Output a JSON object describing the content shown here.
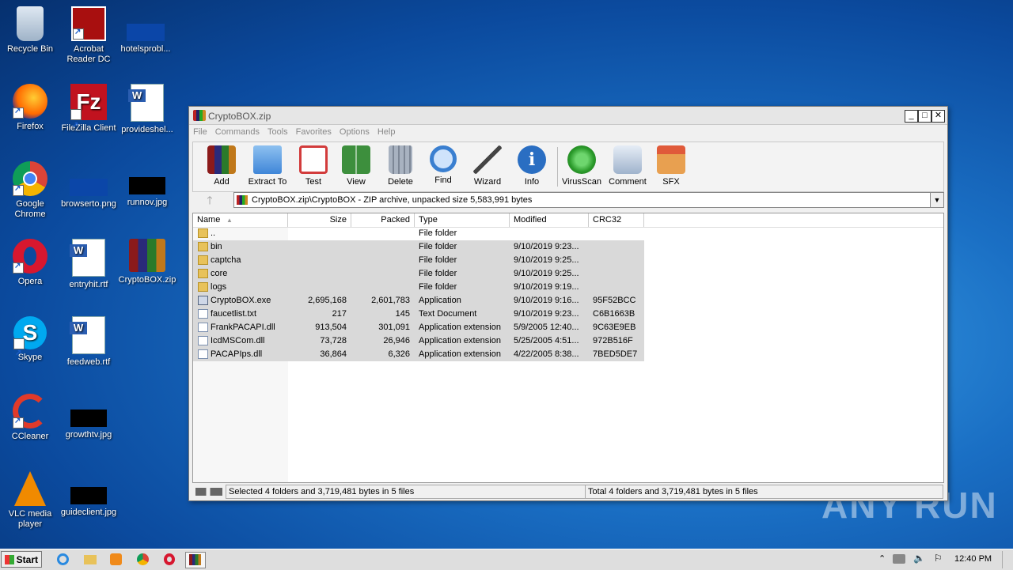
{
  "desktop": {
    "icons": [
      {
        "label": "Recycle Bin"
      },
      {
        "label": "Acrobat Reader DC"
      },
      {
        "label": "hotelsprobl..."
      },
      {
        "label": "Firefox"
      },
      {
        "label": "FileZilla Client"
      },
      {
        "label": "provideshel..."
      },
      {
        "label": "Google Chrome"
      },
      {
        "label": "browserto.png"
      },
      {
        "label": "runnov.jpg"
      },
      {
        "label": "Opera"
      },
      {
        "label": "entryhit.rtf"
      },
      {
        "label": "CryptoBOX.zip"
      },
      {
        "label": "Skype"
      },
      {
        "label": "feedweb.rtf"
      },
      {
        "label": "CCleaner"
      },
      {
        "label": "growthtv.jpg"
      },
      {
        "label": "VLC media player"
      },
      {
        "label": "guideclient.jpg"
      }
    ],
    "watermark": "ANY RUN"
  },
  "window": {
    "title": "CryptoBOX.zip",
    "controls": {
      "minimize": "_",
      "maximize": "□",
      "close": "✕"
    },
    "menu": [
      "File",
      "Commands",
      "Tools",
      "Favorites",
      "Options",
      "Help"
    ],
    "toolbar": [
      {
        "label": "Add",
        "icon": "add-archive-icon",
        "color": "#c83a2a"
      },
      {
        "label": "Extract To",
        "icon": "extract-folder-icon",
        "color": "#4a8fd6"
      },
      {
        "label": "Test",
        "icon": "test-checklist-icon",
        "color": "#d23b3b"
      },
      {
        "label": "View",
        "icon": "view-book-icon",
        "color": "#3d8f3d"
      },
      {
        "label": "Delete",
        "icon": "trash-icon",
        "color": "#8a94a3"
      },
      {
        "label": "Find",
        "icon": "magnifier-icon",
        "color": "#3a7fd0"
      },
      {
        "label": "Wizard",
        "icon": "wand-icon",
        "color": "#5a5a5a"
      },
      {
        "label": "Info",
        "icon": "info-icon",
        "color": "#2a6ec2"
      },
      {
        "label": "VirusScan",
        "icon": "virus-scan-icon",
        "color": "#3aa83a"
      },
      {
        "label": "Comment",
        "icon": "comment-icon",
        "color": "#8aa0bd"
      },
      {
        "label": "SFX",
        "icon": "sfx-box-icon",
        "color": "#d98a3a"
      }
    ],
    "address": "CryptoBOX.zip\\CryptoBOX - ZIP archive, unpacked size 5,583,991 bytes",
    "columns": [
      "Name",
      "Size",
      "Packed",
      "Type",
      "Modified",
      "CRC32"
    ],
    "rows": [
      {
        "name": "..",
        "size": "",
        "packed": "",
        "type": "File folder",
        "modified": "",
        "crc": "",
        "kind": "folder",
        "selected": false
      },
      {
        "name": "bin",
        "size": "",
        "packed": "",
        "type": "File folder",
        "modified": "9/10/2019 9:23...",
        "crc": "",
        "kind": "folder",
        "selected": true
      },
      {
        "name": "captcha",
        "size": "",
        "packed": "",
        "type": "File folder",
        "modified": "9/10/2019 9:25...",
        "crc": "",
        "kind": "folder",
        "selected": true
      },
      {
        "name": "core",
        "size": "",
        "packed": "",
        "type": "File folder",
        "modified": "9/10/2019 9:25...",
        "crc": "",
        "kind": "folder",
        "selected": true
      },
      {
        "name": "logs",
        "size": "",
        "packed": "",
        "type": "File folder",
        "modified": "9/10/2019 9:19...",
        "crc": "",
        "kind": "folder",
        "selected": true
      },
      {
        "name": "CryptoBOX.exe",
        "size": "2,695,168",
        "packed": "2,601,783",
        "type": "Application",
        "modified": "9/10/2019 9:16...",
        "crc": "95F52BCC",
        "kind": "exe",
        "selected": true
      },
      {
        "name": "faucetlist.txt",
        "size": "217",
        "packed": "145",
        "type": "Text Document",
        "modified": "9/10/2019 9:23...",
        "crc": "C6B1663B",
        "kind": "file",
        "selected": true
      },
      {
        "name": "FrankPACAPI.dll",
        "size": "913,504",
        "packed": "301,091",
        "type": "Application extension",
        "modified": "5/9/2005 12:40...",
        "crc": "9C63E9EB",
        "kind": "file",
        "selected": true
      },
      {
        "name": "IcdMSCom.dll",
        "size": "73,728",
        "packed": "26,946",
        "type": "Application extension",
        "modified": "5/25/2005 4:51...",
        "crc": "972B516F",
        "kind": "file",
        "selected": true
      },
      {
        "name": "PACAPIps.dll",
        "size": "36,864",
        "packed": "6,326",
        "type": "Application extension",
        "modified": "4/22/2005 8:38...",
        "crc": "7BED5DE7",
        "kind": "file",
        "selected": true
      }
    ],
    "status_left": "Selected 4 folders and 3,719,481 bytes in 5 files",
    "status_right": "Total 4 folders and 3,719,481 bytes in 5 files"
  },
  "taskbar": {
    "start": "Start",
    "clock": "12:40 PM"
  }
}
